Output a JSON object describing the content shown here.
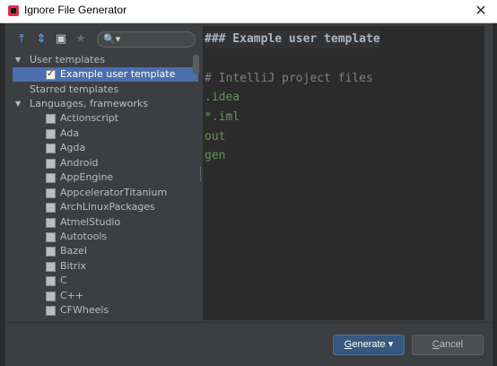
{
  "window": {
    "title": "Ignore File Generator",
    "close_glyph": "✕"
  },
  "toolbar": {
    "expand_all_icon": "expand-all-icon",
    "collapse_all_icon": "collapse-all-icon",
    "unselect_all_icon": "unselect-all-icon",
    "star_icon": "star-icon",
    "search_icon_glyph": "🔍▾",
    "search_value": ""
  },
  "tree": {
    "user_templates_label": "User templates",
    "example_template_label": "Example user template",
    "starred_templates_label": "Starred templates",
    "languages_label": "Languages, frameworks",
    "languages": [
      "Actionscript",
      "Ada",
      "Agda",
      "Android",
      "AppEngine",
      "AppceleratorTitanium",
      "ArchLinuxPackages",
      "AtmelStudio",
      "Autotools",
      "Bazel",
      "Bitrix",
      "C",
      "C++",
      "CFWheels"
    ]
  },
  "editor": {
    "lines": [
      "### Example user template",
      "",
      "# IntelliJ project files",
      ".idea",
      "*.iml",
      "out",
      "gen"
    ]
  },
  "buttons": {
    "generate_mnemonic": "G",
    "generate_rest": "enerate",
    "generate_arrow": " ▾",
    "cancel_mnemonic": "C",
    "cancel_rest": "ancel"
  },
  "colors": {
    "heading": "#a9b7c6",
    "comment": "#808080",
    "entry": "#629755",
    "selection": "#4b6eaf",
    "primary_button": "#365880"
  }
}
